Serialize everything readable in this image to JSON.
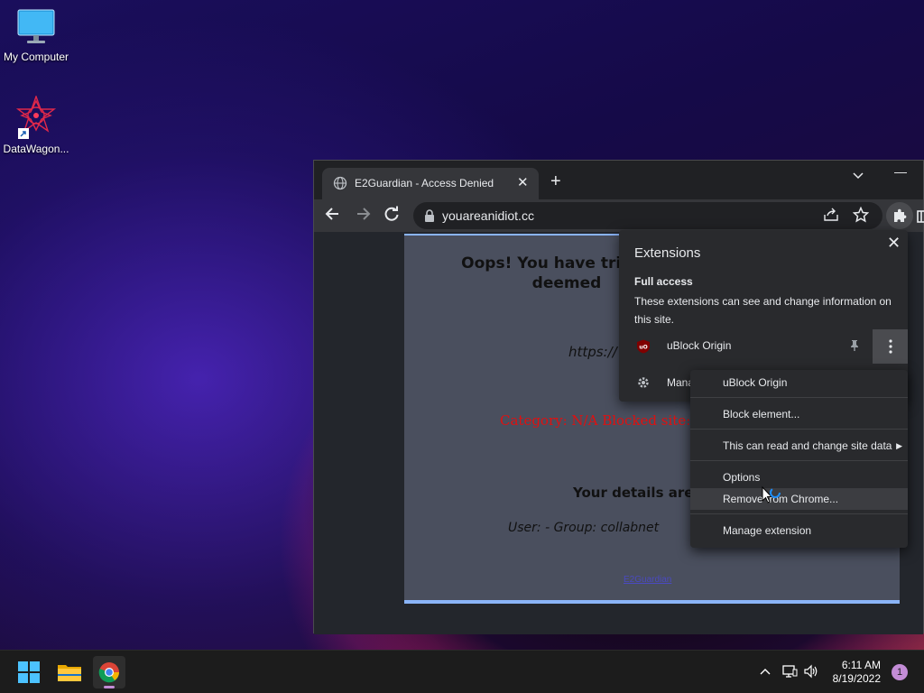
{
  "desktop": {
    "icons": [
      {
        "label": "My Computer"
      },
      {
        "label": "DataWagon..."
      }
    ]
  },
  "chrome": {
    "tab_title": "E2Guardian - Access Denied",
    "url": "youareanidiot.cc"
  },
  "page": {
    "headline": "Oops! You have tried vis\ndeemed",
    "blocked_url": "https://",
    "category": "Category: N/A   Blocked site:",
    "details": "Your details are b",
    "user": "User: -    Group: collabnet",
    "footer_link": "E2Guardian"
  },
  "extensions_popup": {
    "title": "Extensions",
    "full_access_heading": "Full access",
    "full_access_desc": "These extensions can see and change information on this site.",
    "extension_name": "uBlock Origin",
    "manage_label": "Mana"
  },
  "context_menu": {
    "header": "uBlock Origin",
    "block_element": "Block element...",
    "site_data": "This can read and change site data",
    "options": "Options",
    "remove": "Remove from Chrome...",
    "manage_extension": "Manage extension"
  },
  "taskbar": {
    "time": "6:11 AM",
    "date": "8/19/2022",
    "notification_count": "1"
  },
  "colors": {
    "accent": "#8ab4f8",
    "blocked_text": "#e01010",
    "notification": "#c38cd6"
  }
}
